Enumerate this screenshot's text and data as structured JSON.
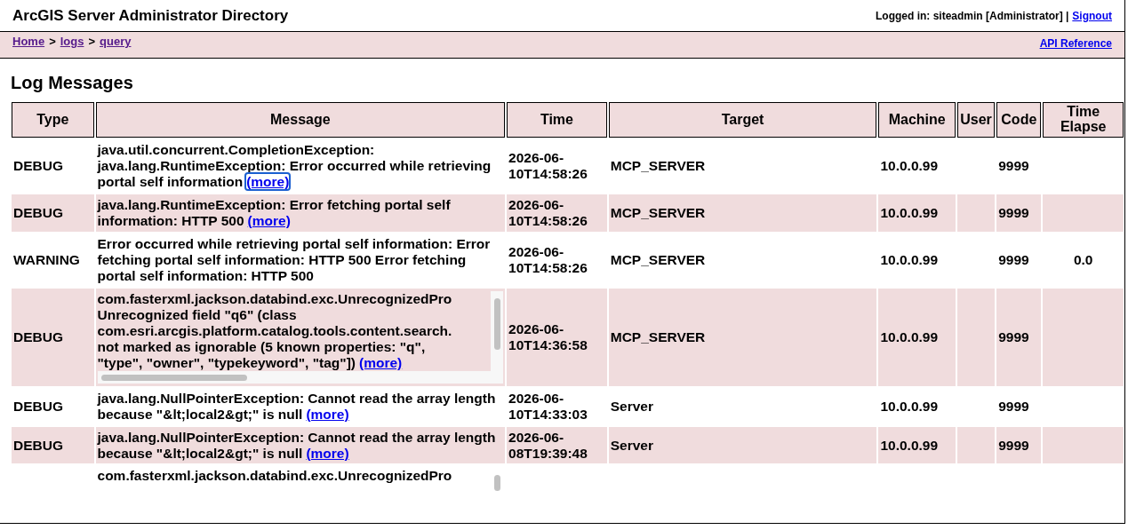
{
  "header": {
    "title": "ArcGIS Server Administrator Directory",
    "login_text": "Logged in: siteadmin [Administrator] |",
    "signout": "Signout"
  },
  "breadcrumb": [
    {
      "kind": "link",
      "label": "Home"
    },
    {
      "kind": "separator",
      "label": ">"
    },
    {
      "kind": "link",
      "label": "logs"
    },
    {
      "kind": "separator",
      "label": ">"
    },
    {
      "kind": "link",
      "label": "query"
    }
  ],
  "api_reference": "API Reference",
  "page_title": "Log Messages",
  "table": {
    "columns": [
      "Type",
      "Message",
      "Time",
      "Target",
      "Machine",
      "User",
      "Code",
      "Time Elapse"
    ],
    "rows": [
      {
        "kind": "text",
        "type": "DEBUG",
        "message": "java.util.concurrent.CompletionException: java.lang.RuntimeException: Error occurred while retrieving portal self information",
        "more": "(more)",
        "more_focused": true,
        "time": "2026-06-10T14:58:26",
        "target": "MCP_SERVER",
        "machine": "10.0.0.99",
        "code": "9999"
      },
      {
        "kind": "text",
        "type": "DEBUG",
        "message": "java.lang.RuntimeException: Error fetching portal self information: HTTP 500",
        "more": "(more)",
        "more_focused": false,
        "time": "2026-06-10T14:58:26",
        "target": "MCP_SERVER",
        "machine": "10.0.0.99",
        "code": "9999"
      },
      {
        "kind": "text",
        "type": "WARNING",
        "message": "Error occurred while retrieving portal self information: Error fetching portal self information: HTTP 500 Error fetching portal self information: HTTP 500",
        "time": "2026-06-10T14:58:26",
        "target": "MCP_SERVER",
        "machine": "10.0.0.99",
        "code": "9999",
        "time_elapsed": "0.0"
      },
      {
        "kind": "scroll",
        "type": "DEBUG",
        "message_lines": [
          "com.fasterxml.jackson.databind.exc.UnrecognizedPro",
          "Unrecognized field \"q6\" (class",
          "com.esri.arcgis.platform.catalog.tools.content.search.",
          "not marked as ignorable (5 known properties: \"q\",",
          "\"type\", \"owner\", \"typekeyword\", \"tag\"])"
        ],
        "box_more": "(more)",
        "more_focused": false,
        "time": "2026-06-10T14:36:58",
        "target": "MCP_SERVER",
        "machine": "10.0.0.99",
        "code": "9999"
      },
      {
        "kind": "text",
        "type": "DEBUG",
        "message": "java.lang.NullPointerException: Cannot read the array length because \"&lt;local2&gt;\" is null",
        "more": "(more)",
        "more_focused": false,
        "time": "2026-06-10T14:33:03",
        "target": "Server",
        "machine": "10.0.0.99",
        "code": "9999"
      },
      {
        "kind": "text",
        "type": "DEBUG",
        "message": "java.lang.NullPointerException: Cannot read the array length because \"&lt;local2&gt;\" is null",
        "more": "(more)",
        "more_focused": false,
        "time": "2026-06-08T19:39:48",
        "target": "Server",
        "machine": "10.0.0.99",
        "code": "9999"
      },
      {
        "kind": "scroll",
        "message_lines": [
          "com.fasterxml.jackson.databind.exc.UnrecognizedPro"
        ]
      }
    ]
  }
}
